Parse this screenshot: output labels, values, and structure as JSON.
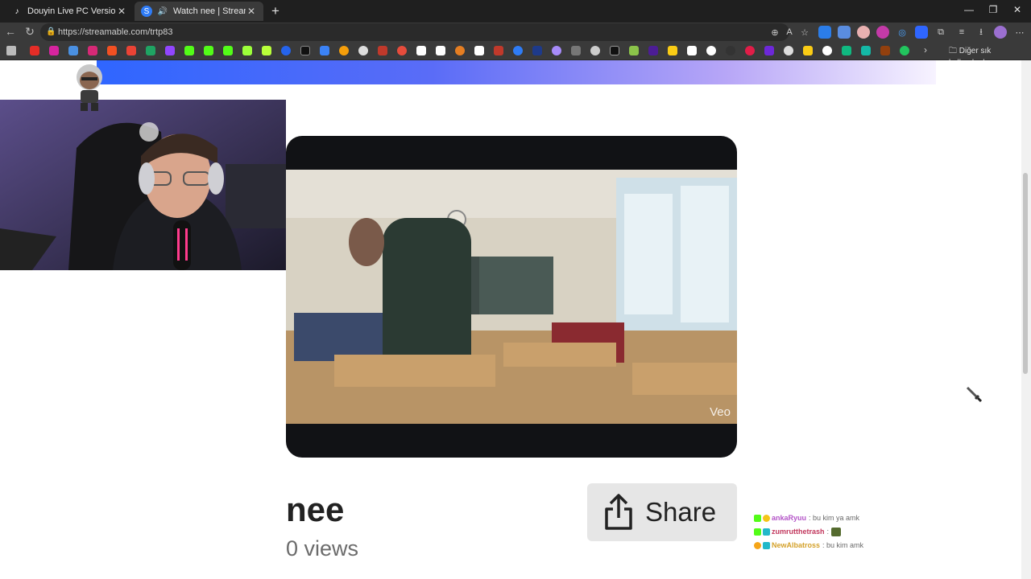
{
  "browser": {
    "tabs": [
      {
        "title": "Douyin Live PC Version_Douyin Liv",
        "active": false
      },
      {
        "title": "Watch nee | Streamable",
        "active": true
      }
    ],
    "url": "https://streamable.com/trtp83",
    "bookmarks_folder": "Diğer sık kullanılanlar"
  },
  "video": {
    "title": "nee",
    "views": "0 views",
    "watermark": "Veo"
  },
  "share": {
    "label": "Share"
  },
  "chat": [
    {
      "user": "",
      "message": ""
    },
    {
      "user": "ankaRyuu",
      "message": "bu kim ya amk",
      "color": "#b455c8"
    },
    {
      "user": "zumrutthetrash",
      "message": "",
      "color": "#c1365c"
    },
    {
      "user": "NewAlbatross",
      "message": "bu kim amk",
      "color": "#d4a12a"
    }
  ],
  "colors": {
    "accent_banner": "#2f66ff",
    "chrome_dark": "#1f1f1f",
    "share_bg": "#e6e6e6"
  }
}
